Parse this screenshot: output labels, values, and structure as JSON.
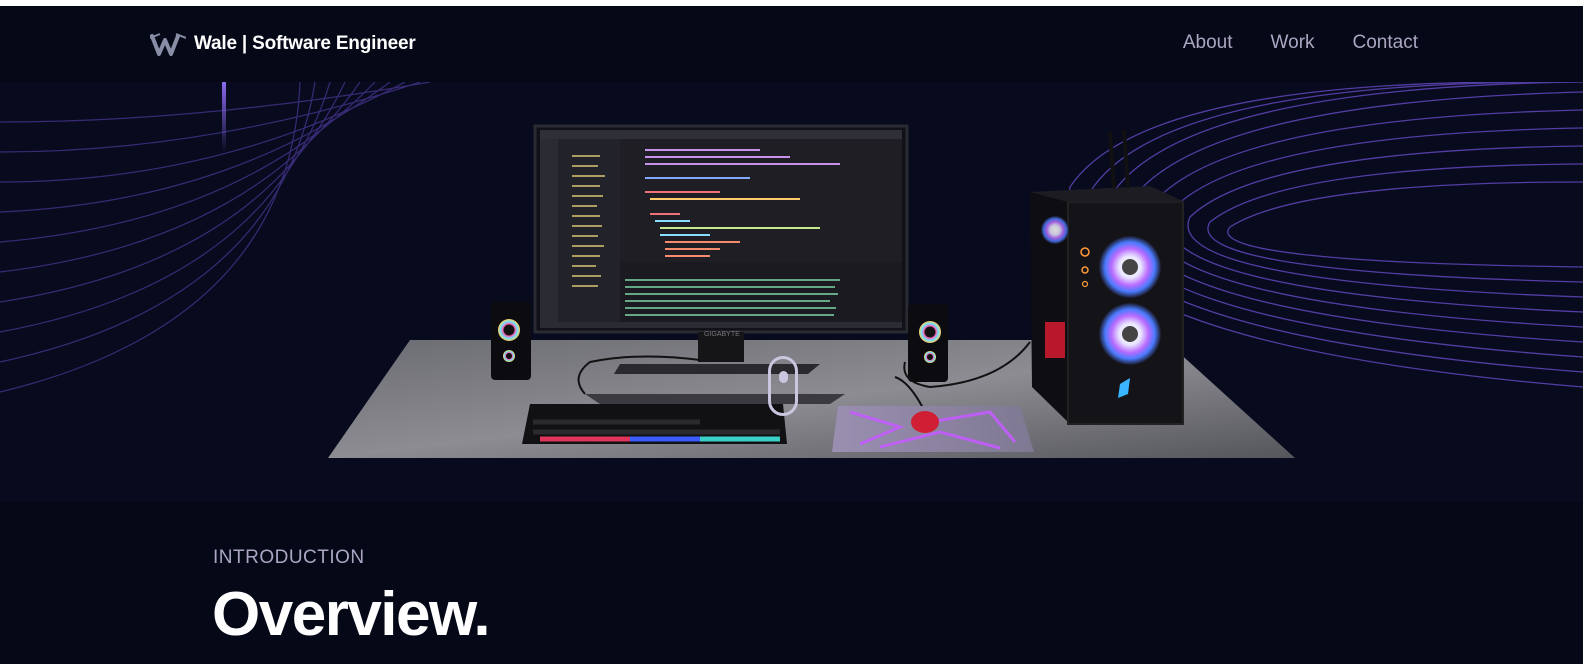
{
  "navbar": {
    "logo_icon": "w-logo-icon",
    "brand": "Wale | Software Engineer",
    "links": [
      {
        "label": "About"
      },
      {
        "label": "Work"
      },
      {
        "label": "Contact"
      }
    ]
  },
  "hero": {
    "scene_description": "3d-computer-desk-scene",
    "scroll_icon": "mouse-scroll-icon",
    "monitor_brand": "GIGABYTE"
  },
  "section": {
    "subtitle": "INTRODUCTION",
    "title": "Overview."
  },
  "colors": {
    "background": "#050816",
    "accent": "#915eff",
    "secondary_text": "#aaa6c3"
  }
}
